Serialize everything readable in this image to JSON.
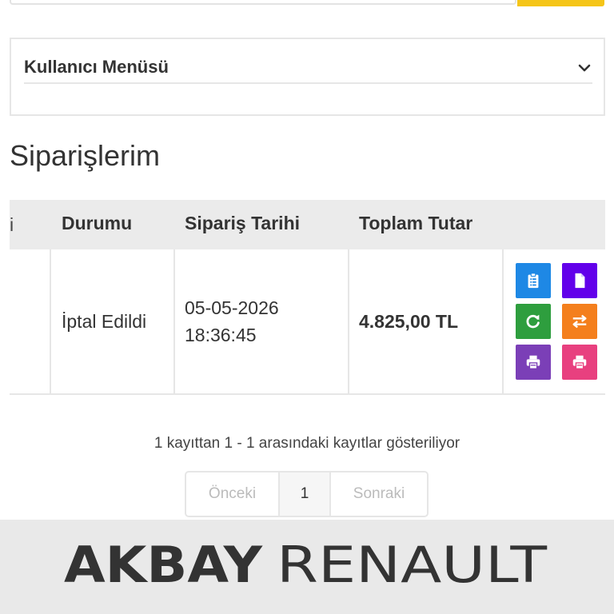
{
  "user_menu": {
    "title": "Kullanıcı Menüsü"
  },
  "page": {
    "title": "Siparişlerim"
  },
  "table": {
    "columns": [
      "Durumu",
      "Sipariş Tarihi",
      "Toplam Tutar"
    ],
    "rows": [
      {
        "status": "İptal Edildi",
        "date": "05-05-2026",
        "time": "18:36:45",
        "total": "4.825,00 TL"
      }
    ],
    "actions": [
      {
        "icon": "clipboard-list-icon",
        "color": "#1e88e5"
      },
      {
        "icon": "file-icon",
        "color": "#6200ea"
      },
      {
        "icon": "refresh-icon",
        "color": "#2e9e3e"
      },
      {
        "icon": "exchange-icon",
        "color": "#f47f1d"
      },
      {
        "icon": "print-icon",
        "color": "#7b3fb7"
      },
      {
        "icon": "print-icon",
        "color": "#e8407f"
      }
    ]
  },
  "pagination": {
    "info": "1 kayıttan 1 - 1 arasındaki kayıtlar gösteriliyor",
    "prev": "Önceki",
    "current": "1",
    "next": "Sonraki"
  },
  "footer": {
    "logo_part1": "AKBAY",
    "logo_part2": "RENAULT"
  },
  "colors": {
    "accent": "#f5c518",
    "header_bg": "#ebebeb",
    "footer_bg": "#e9e9e9"
  }
}
